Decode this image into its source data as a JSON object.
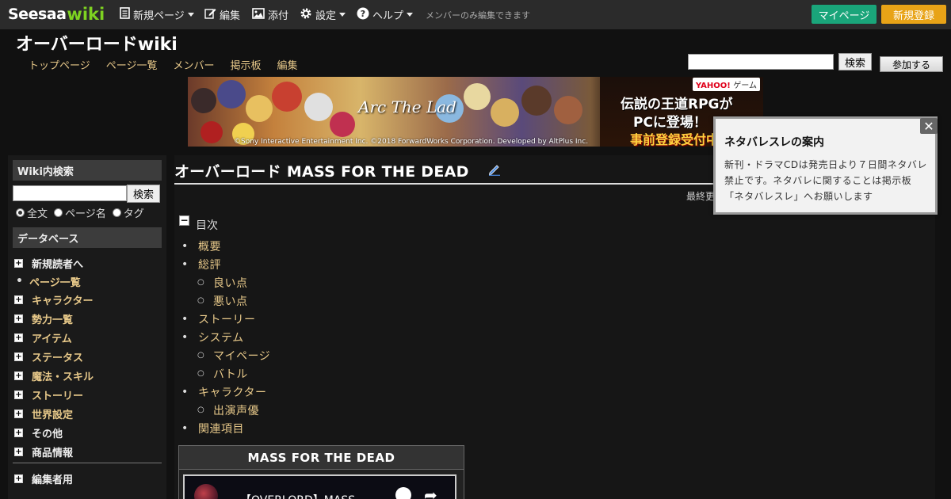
{
  "topbar": {
    "logo_main": "Seesaa",
    "logo_wiki": "wiki",
    "menu": {
      "new_page": "新規ページ",
      "edit": "編集",
      "attach": "添付",
      "settings": "設定",
      "help": "ヘルプ"
    },
    "members_only_notice": "メンバーのみ編集できます",
    "mypage_label": "マイページ",
    "signup_label": "新規登録"
  },
  "header": {
    "site_title": "オーバーロードwiki",
    "nav": [
      "トップページ",
      "ページ一覧",
      "メンバー",
      "掲示板",
      "編集"
    ],
    "search_button": "検索",
    "join_button": "参加する"
  },
  "banner": {
    "game_title": "Arc The Lad",
    "copyright": "©Sony Interactive Entertainment Inc. ©2018 ForwardWorks Corporation. Developed by AltPlus Inc.",
    "yahoo_badge": "YAHOO!",
    "yahoo_badge_sub": "ゲーム",
    "line1": "伝説の王道RPGが",
    "line2": "PCに登場！",
    "line3": "事前登録受付中"
  },
  "sidebar": {
    "search_heading": "Wiki内検索",
    "search_button": "検索",
    "radio_options": [
      {
        "label": "全文",
        "checked": true
      },
      {
        "label": "ページ名",
        "checked": false
      },
      {
        "label": "タグ",
        "checked": false
      }
    ],
    "database_heading": "データベース",
    "items": [
      {
        "label": "新規読者へ",
        "kind": "expand",
        "color": "white"
      },
      {
        "label": "ページ一覧",
        "kind": "bullet",
        "color": "gold"
      },
      {
        "label": "キャラクター",
        "kind": "expand",
        "color": "gold"
      },
      {
        "label": "勢力一覧",
        "kind": "expand",
        "color": "gold"
      },
      {
        "label": "アイテム",
        "kind": "expand",
        "color": "gold"
      },
      {
        "label": "ステータス",
        "kind": "expand",
        "color": "gold"
      },
      {
        "label": "魔法・スキル",
        "kind": "expand",
        "color": "gold"
      },
      {
        "label": "ストーリー",
        "kind": "expand",
        "color": "gold"
      },
      {
        "label": "世界設定",
        "kind": "expand",
        "color": "gold"
      },
      {
        "label": "その他",
        "kind": "expand",
        "color": "white"
      },
      {
        "label": "商品情報",
        "kind": "expand",
        "color": "white"
      }
    ],
    "editors_label": "編集者用"
  },
  "main": {
    "page_title": "オーバーロード MASS FOR THE DEAD",
    "last_updated_partial": "最終更",
    "toc_title": "目次",
    "toc": [
      {
        "label": "概要",
        "level": 1
      },
      {
        "label": "総評",
        "level": 1
      },
      {
        "label": "良い点",
        "level": 2
      },
      {
        "label": "悪い点",
        "level": 2
      },
      {
        "label": "ストーリー",
        "level": 1
      },
      {
        "label": "システム",
        "level": 1
      },
      {
        "label": "マイページ",
        "level": 2
      },
      {
        "label": "バトル",
        "level": 2
      },
      {
        "label": "キャラクター",
        "level": 1
      },
      {
        "label": "出演声優",
        "level": 2
      },
      {
        "label": "関連項目",
        "level": 1
      }
    ],
    "video_box_title": "MASS FOR THE DEAD",
    "video_title": "【OVERLORD】MASS"
  },
  "popup": {
    "title": "ネタバレスレの案内",
    "body": "新刊・ドラマCDは発売日より７日間ネタバレ禁止です。ネタバレに関することは掲示板「ネタバレスレ」へお願いします",
    "close_label": "✕"
  },
  "colors": {
    "accent_gold": "#e8c98a",
    "mypage_green": "#1aa57a",
    "signup_orange": "#e8a317",
    "logo_wiki_green": "#7ed321"
  }
}
